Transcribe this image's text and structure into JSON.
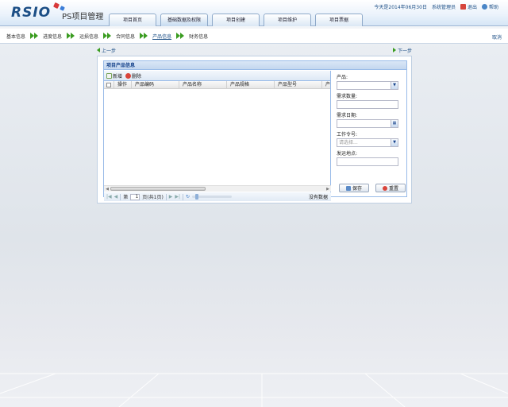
{
  "header": {
    "logo_text": "RSIO",
    "app_title": "PS项目管理",
    "date_text": "今天是2014年06月30日",
    "user_name": "系统管理员",
    "logout_label": "退出",
    "help_label": "帮助",
    "colors": {
      "brand": "#1d4f86",
      "logo_red": "#d83a3a",
      "logo_blue": "#3b7dd8"
    }
  },
  "tabs": [
    {
      "label": "项目首页"
    },
    {
      "label": "基础数据及权限"
    },
    {
      "label": "项目创建"
    },
    {
      "label": "项目维护"
    },
    {
      "label": "项目票据"
    }
  ],
  "steps": {
    "items": [
      {
        "label": "基本信息"
      },
      {
        "label": "进度信息"
      },
      {
        "label": "运损信息"
      },
      {
        "label": "合同信息"
      },
      {
        "label": "产品信息",
        "current": true
      },
      {
        "label": "财务信息"
      }
    ],
    "cancel_label": "取消"
  },
  "nav": {
    "prev_label": "上一步",
    "next_label": "下一步"
  },
  "panel": {
    "title": "项目产品信息",
    "toolbar": {
      "add_label": "新增",
      "delete_label": "删除"
    },
    "columns": [
      "操作",
      "产品编码",
      "产品名称",
      "产品规格",
      "产品型号",
      "产"
    ],
    "rows": [],
    "pager": {
      "page_prefix": "第",
      "page_value": "1",
      "page_suffix": "页(共1页)",
      "empty_text": "没有数据"
    }
  },
  "form": {
    "product_label": "产品:",
    "quantity_label": "需求数量:",
    "date_label": "需求日期:",
    "work_order_label": "工作令号:",
    "work_order_placeholder": "请选择...",
    "ship_location_label": "发运地点:",
    "save_label": "保存",
    "reset_label": "重置"
  }
}
